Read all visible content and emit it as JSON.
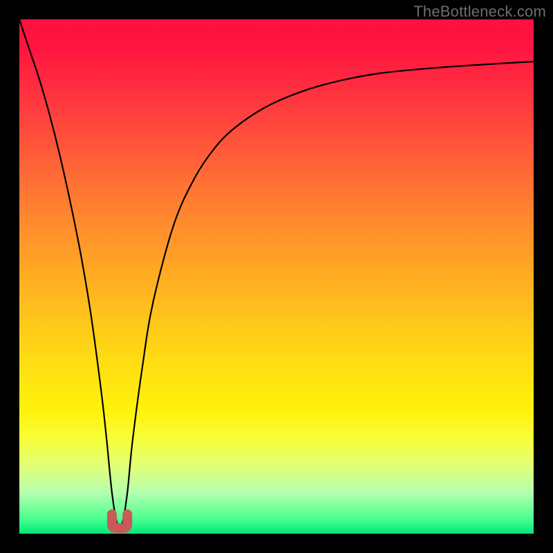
{
  "watermark": "TheBottleneck.com",
  "chart_data": {
    "type": "line",
    "title": "",
    "xlabel": "",
    "ylabel": "",
    "xlim": [
      0,
      100
    ],
    "ylim": [
      0,
      100
    ],
    "gradient_meaning": "background encodes bottleneck severity: top (red) ≈ high, bottom (green) ≈ low",
    "series": [
      {
        "name": "bottleneck-curve",
        "x": [
          0,
          2,
          4,
          6,
          8,
          10,
          12,
          14,
          16,
          17,
          18,
          19,
          20,
          21,
          22,
          24,
          26,
          30,
          34,
          38,
          42,
          48,
          55,
          62,
          70,
          80,
          90,
          100
        ],
        "y": [
          100,
          94,
          88,
          81,
          73,
          64,
          54,
          42,
          27,
          18,
          8,
          2,
          2,
          8,
          18,
          33,
          45,
          60,
          69,
          75,
          79,
          83,
          86,
          88,
          89.5,
          90.5,
          91.2,
          91.8
        ]
      }
    ],
    "valley_marker": {
      "x": 19.5,
      "width": 3,
      "depth": 2
    }
  }
}
